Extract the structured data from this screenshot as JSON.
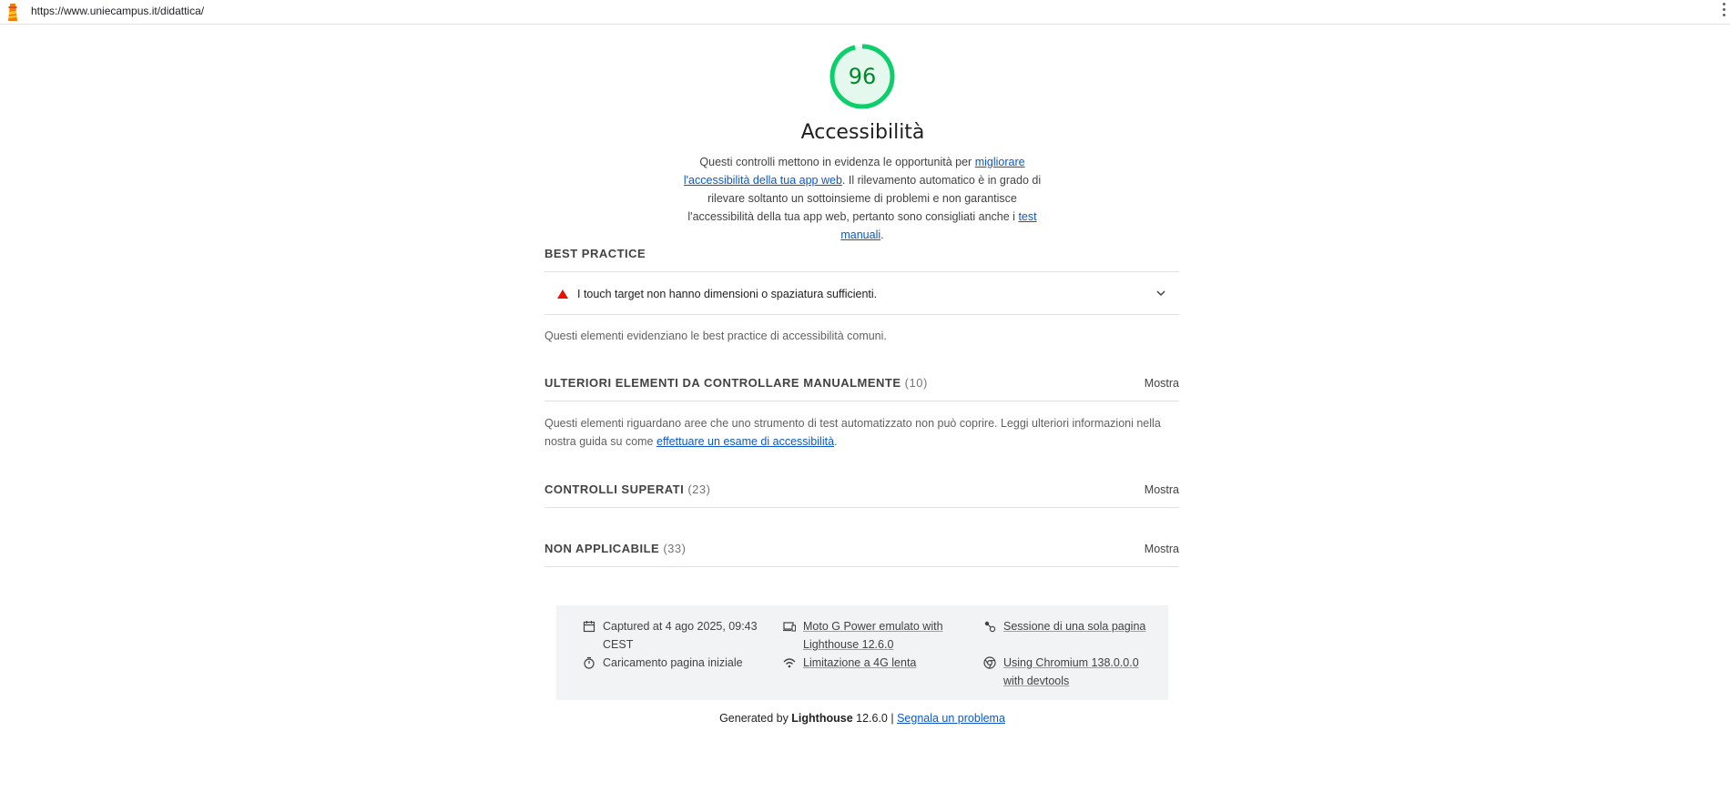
{
  "browser": {
    "url": "https://www.uniecampus.it/didattica/"
  },
  "score": {
    "value": "96",
    "fraction": 0.96,
    "color": "#0cce6b"
  },
  "category": {
    "title": "Accessibilità",
    "desc_part1": "Questi controlli mettono in evidenza le opportunità per ",
    "desc_link1": "migliorare l'accessibilità della tua app web",
    "desc_part2": ". Il rilevamento automatico è in grado di rilevare soltanto un sottoinsieme di problemi e non garantisce l'accessibilità della tua app web, pertanto sono consigliati anche i ",
    "desc_link2": "test manuali",
    "desc_part3": "."
  },
  "best_practice": {
    "heading": "BEST PRACTICE",
    "audit_title": "I touch target non hanno dimensioni o spaziatura sufficienti.",
    "audit_status_color": "#eb0f00",
    "description": "Questi elementi evidenziano le best practice di accessibilità comuni."
  },
  "manual": {
    "heading": "ULTERIORI ELEMENTI DA CONTROLLARE MANUALMENTE",
    "count": "(10)",
    "toggle": "Mostra",
    "desc_part1": "Questi elementi riguardano aree che uno strumento di test automatizzato non può coprire. Leggi ulteriori informazioni nella nostra guida su come ",
    "desc_link": "effettuare un esame di accessibilità",
    "desc_part2": "."
  },
  "passed": {
    "heading": "CONTROLLI SUPERATI",
    "count": "(23)",
    "toggle": "Mostra"
  },
  "not_applicable": {
    "heading": "NON APPLICABILE",
    "count": "(33)",
    "toggle": "Mostra"
  },
  "runtime": {
    "captured": "Captured at 4 ago 2025, 09:43 CEST",
    "page_load": "Caricamento pagina iniziale",
    "device": "Moto G Power emulato with Lighthouse 12.6.0",
    "throttling": "Limitazione a 4G lenta",
    "session": "Sessione di una sola pagina",
    "browser": "Using Chromium 138.0.0.0 with devtools"
  },
  "generated": {
    "prefix": "Generated by ",
    "tool": "Lighthouse",
    "version": " 12.6.0 | ",
    "report_link": "Segnala un problema"
  }
}
